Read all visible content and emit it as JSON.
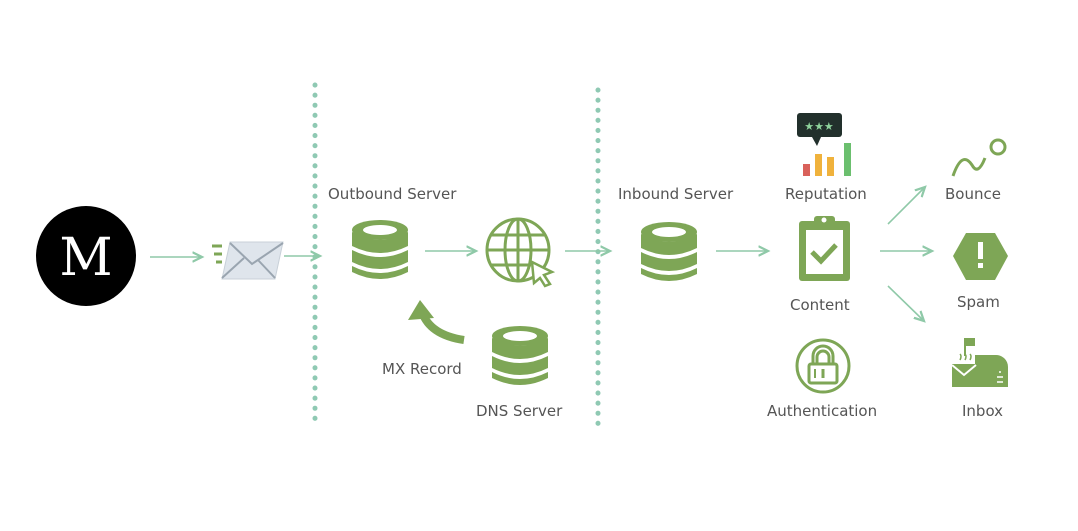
{
  "logo": {
    "letter": "M"
  },
  "labels": {
    "outbound_server": "Outbound Server",
    "mx_record": "MX Record",
    "dns_server": "DNS Server",
    "inbound_server": "Inbound Server",
    "reputation": "Reputation",
    "content": "Content",
    "authentication": "Authentication",
    "bounce": "Bounce",
    "spam": "Spam",
    "inbox": "Inbox"
  },
  "icons": [
    "envelope-icon",
    "database-icon",
    "globe-cursor-icon",
    "curved-arrow-icon",
    "rating-chart-icon",
    "clipboard-check-icon",
    "lock-icon",
    "bounce-icon",
    "warning-hexagon-icon",
    "mailbox-icon"
  ],
  "colors": {
    "accent_green": "#7ea656",
    "arrow": "#8fc9a8",
    "dots": "#8fc9b3",
    "text": "#555555"
  }
}
